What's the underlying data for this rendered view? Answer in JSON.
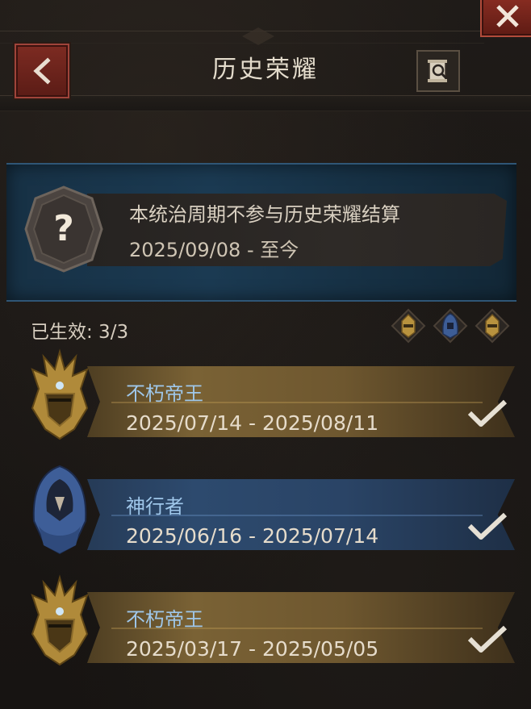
{
  "header": {
    "title": "历史荣耀"
  },
  "icons": {
    "back": "back-arrow-icon",
    "close": "close-x-icon",
    "rules": "scroll-magnifier-icon",
    "info_badge": "question-mark-badge-icon",
    "check": "checkmark-icon"
  },
  "info_banner": {
    "line1": "本统治周期不参与历史荣耀结算",
    "line2": "2025/09/08 - 至今"
  },
  "effective": {
    "label": "已生效: 3/3",
    "icons": [
      "gold-helm-icon",
      "blue-hood-icon",
      "gold-helm-icon"
    ]
  },
  "honors": [
    {
      "name": "不朽帝王",
      "dates": "2025/07/14 - 2025/08/11",
      "style": "gold",
      "emblem": "golden-crowned-helm-icon"
    },
    {
      "name": "神行者",
      "dates": "2025/06/16 - 2025/07/14",
      "style": "blue",
      "emblem": "blue-hooded-figure-icon"
    },
    {
      "name": "不朽帝王",
      "dates": "2025/03/17 - 2025/05/05",
      "style": "gold",
      "emblem": "golden-crowned-helm-icon"
    }
  ],
  "colors": {
    "gold": "#7a6235",
    "blue": "#2d4a6e",
    "name_text": "#9fc7ea",
    "accent_red": "#7d2b22"
  }
}
